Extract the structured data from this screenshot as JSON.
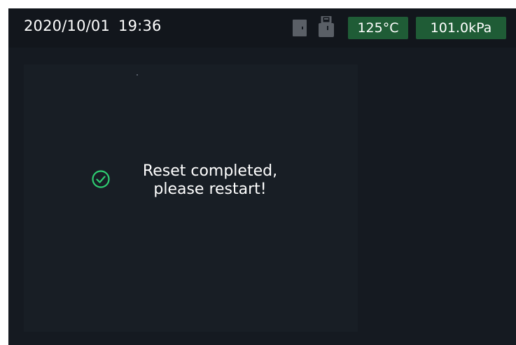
{
  "status_bar": {
    "date": "2020/10/01",
    "time": "19:36",
    "icons": [
      "door-icon",
      "lock-icon"
    ],
    "temperature": "125°C",
    "pressure": "101.0kPa"
  },
  "dialog": {
    "icon": "check-circle-icon",
    "line1": "Reset completed,",
    "line2": "please restart!"
  },
  "colors": {
    "background": "#151a21",
    "panel": "#181e25",
    "badge": "#1f5c36",
    "success": "#2ecc71",
    "icon_muted": "#5a5f66"
  }
}
